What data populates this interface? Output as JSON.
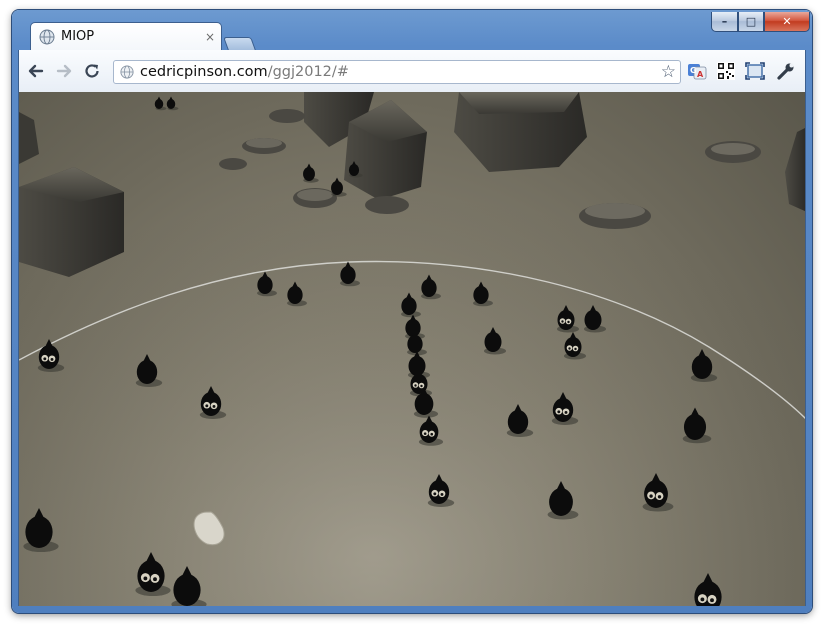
{
  "window": {
    "minimize_glyph": "–",
    "maximize_glyph": "□",
    "close_glyph": "✕"
  },
  "tabs": [
    {
      "title": "MIOP",
      "favicon": "globe-icon",
      "close_glyph": "×"
    }
  ],
  "toolbar": {
    "back_icon": "back-arrow-icon",
    "forward_icon": "forward-arrow-icon",
    "reload_icon": "reload-icon",
    "url_host": "cedricpinson.com",
    "url_path": "/ggj2012/#",
    "bookmark_icon": "star-icon",
    "extensions": [
      "translate-icon",
      "qr-code-icon",
      "screen-capture-icon",
      "wrench-icon"
    ]
  },
  "game": {
    "scene": "3D WebGL game canvas with dark rocks and black creatures on a stone floor",
    "colors": {
      "floor": "#888373",
      "rock": "#3b3a36",
      "creature": "#0c0c0c",
      "ring": "#d8d8d4"
    }
  }
}
